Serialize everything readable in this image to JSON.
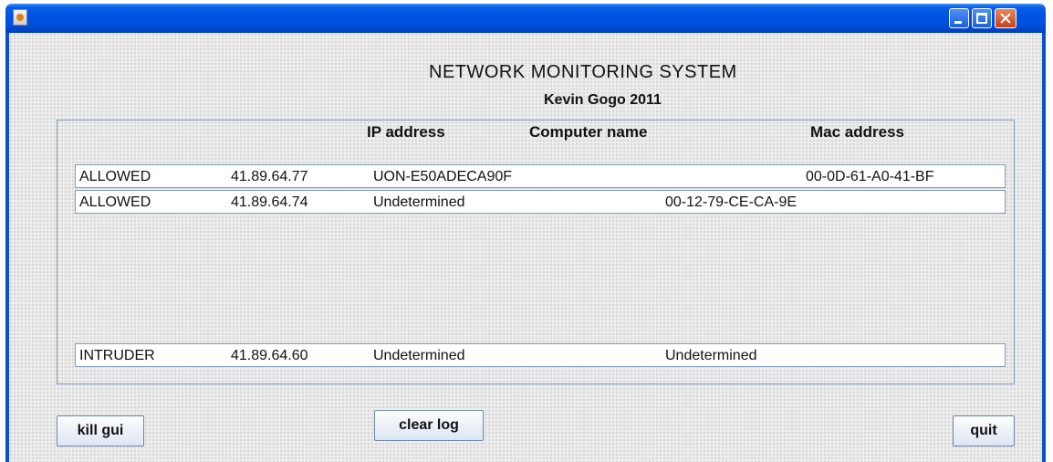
{
  "window": {
    "title": ""
  },
  "header": {
    "title": "NETWORK MONITORING SYSTEM",
    "subtitle": "Kevin Gogo 2011"
  },
  "table": {
    "columns": [
      "IP address",
      "Computer name",
      "Mac address"
    ],
    "rows": [
      {
        "status": "ALLOWED",
        "ip": "41.89.64.77",
        "name": "UON-E50ADECA90F",
        "mac": "00-0D-61-A0-41-BF"
      },
      {
        "status": "ALLOWED",
        "ip": "41.89.64.74",
        "name": "Undetermined",
        "mac": "00-12-79-CE-CA-9E"
      },
      {
        "status": "INTRUDER",
        "ip": "41.89.64.60",
        "name": "Undetermined",
        "mac": "Undetermined"
      }
    ]
  },
  "buttons": {
    "kill": "kill gui",
    "clear": "clear log",
    "quit": "quit"
  },
  "colors": {
    "titlebar": "#0054e3",
    "client_bg": "#ececec",
    "border": "#7f9db9"
  },
  "icons": {
    "app": "java-cup-icon",
    "minimize": "minimize-icon",
    "maximize": "maximize-icon",
    "close": "close-icon"
  }
}
